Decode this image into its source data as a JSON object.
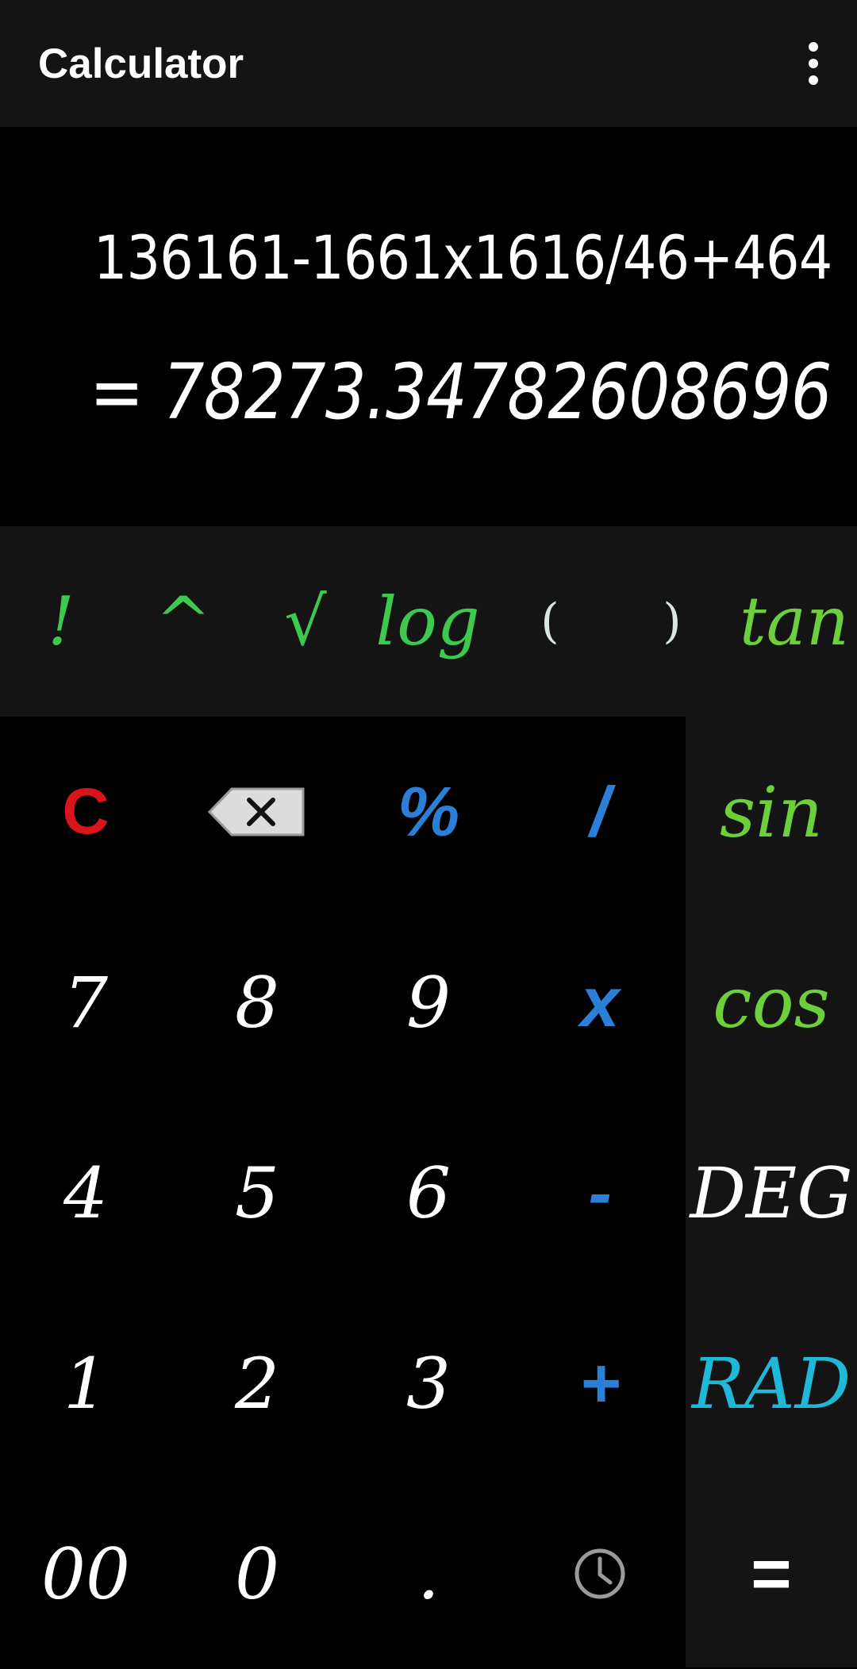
{
  "app_bar": {
    "title": "Calculator",
    "menu_icon": "more-vert-icon"
  },
  "display": {
    "expression": "136161-1661x1616/46+464",
    "result": "= 78273.34782608696"
  },
  "scientific_row": [
    {
      "label": "!",
      "name": "factorial"
    },
    {
      "label": "^",
      "name": "power"
    },
    {
      "label": "√",
      "name": "sqrt"
    },
    {
      "label": "log",
      "name": "log"
    },
    {
      "label": "(",
      "name": "open-paren"
    },
    {
      "label": ")",
      "name": "close-paren"
    },
    {
      "label": "tan",
      "name": "tan"
    }
  ],
  "keypad": {
    "clear": "C",
    "backspace_icon": "backspace-icon",
    "percent": "%",
    "divide": "/",
    "k7": "7",
    "k8": "8",
    "k9": "9",
    "multiply": "x",
    "k4": "4",
    "k5": "5",
    "k6": "6",
    "minus": "-",
    "k1": "1",
    "k2": "2",
    "k3": "3",
    "plus": "+",
    "k00": "00",
    "k0": "0",
    "dot": ".",
    "history_icon": "history-icon"
  },
  "side_panel": {
    "sin": "sin",
    "cos": "cos",
    "deg": "DEG",
    "rad": "RAD",
    "equals": "="
  },
  "colors": {
    "app_bar_bg": "#141414",
    "display_bg": "#000000",
    "function_green": "#3dc94d",
    "trig_green": "#6ccf3c",
    "operator_blue": "#2b7fd6",
    "clear_red": "#d9141a",
    "rad_cyan": "#1fb8d6"
  }
}
